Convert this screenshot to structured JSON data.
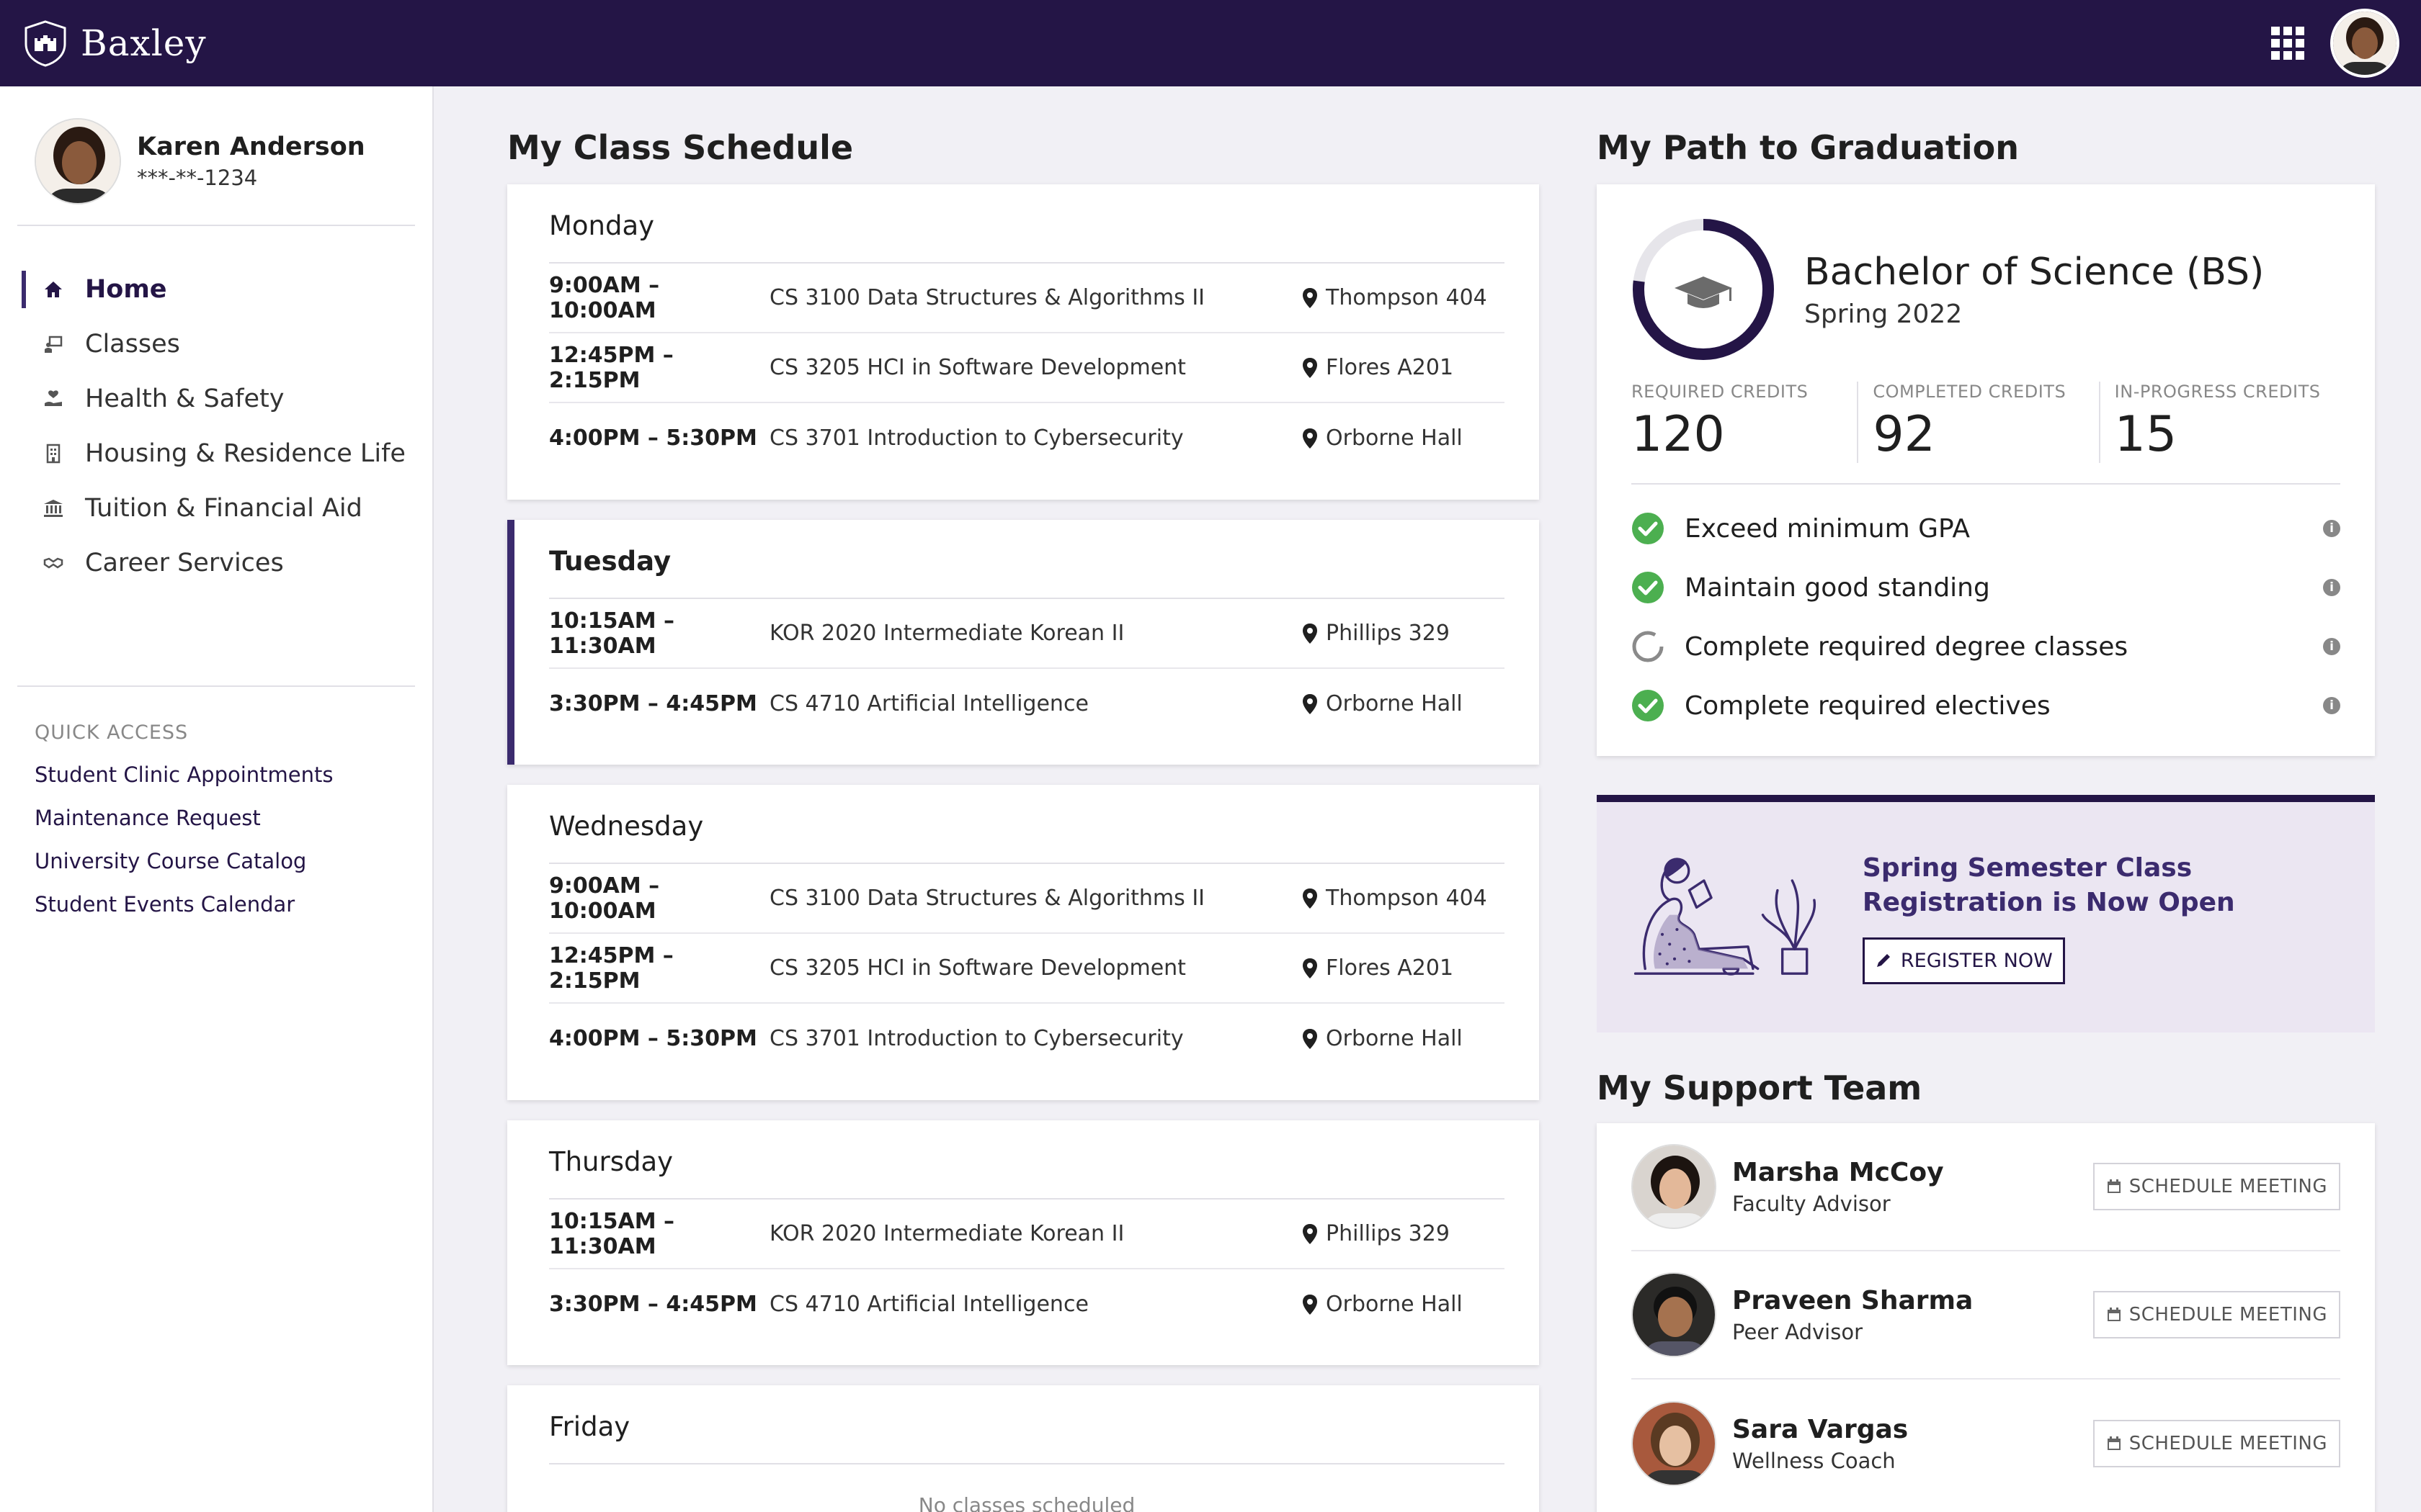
{
  "app": {
    "brand": "Baxley",
    "accent_color": "#241546"
  },
  "user": {
    "name": "Karen Anderson",
    "id_masked": "***-**-1234"
  },
  "nav": {
    "items": [
      {
        "label": "Home",
        "icon": "home-icon",
        "active": true
      },
      {
        "label": "Classes",
        "icon": "classes-icon"
      },
      {
        "label": "Health & Safety",
        "icon": "health-icon"
      },
      {
        "label": "Housing & Residence Life",
        "icon": "building-icon"
      },
      {
        "label": "Tuition & Financial Aid",
        "icon": "bank-icon"
      },
      {
        "label": "Career Services",
        "icon": "handshake-icon"
      }
    ]
  },
  "quick_access": {
    "title": "QUICK ACCESS",
    "links": [
      "Student Clinic Appointments",
      "Maintenance Request",
      "University Course Catalog",
      "Student Events Calendar"
    ]
  },
  "schedule": {
    "title": "My Class Schedule",
    "days": [
      {
        "name": "Monday",
        "classes": [
          {
            "time": "9:00AM – 10:00AM",
            "course": "CS 3100 Data Structures & Algorithms II",
            "location": "Thompson 404"
          },
          {
            "time": "12:45PM – 2:15PM",
            "course": "CS 3205 HCI in Software Development",
            "location": "Flores A201"
          },
          {
            "time": "4:00PM – 5:30PM",
            "course": "CS 3701 Introduction to Cybersecurity",
            "location": "Orborne Hall"
          }
        ]
      },
      {
        "name": "Tuesday",
        "classes": [
          {
            "time": "10:15AM – 11:30AM",
            "course": "KOR 2020 Intermediate Korean II",
            "location": "Phillips 329"
          },
          {
            "time": "3:30PM – 4:45PM",
            "course": "CS 4710 Artificial Intelligence",
            "location": "Orborne Hall"
          }
        ]
      },
      {
        "name": "Wednesday",
        "classes": [
          {
            "time": "9:00AM – 10:00AM",
            "course": "CS 3100 Data Structures & Algorithms II",
            "location": "Thompson 404"
          },
          {
            "time": "12:45PM – 2:15PM",
            "course": "CS 3205 HCI in Software Development",
            "location": "Flores A201"
          },
          {
            "time": "4:00PM – 5:30PM",
            "course": "CS 3701 Introduction to Cybersecurity",
            "location": "Orborne Hall"
          }
        ]
      },
      {
        "name": "Thursday",
        "classes": [
          {
            "time": "10:15AM – 11:30AM",
            "course": "KOR 2020 Intermediate Korean II",
            "location": "Phillips 329"
          },
          {
            "time": "3:30PM – 4:45PM",
            "course": "CS 4710 Artificial Intelligence",
            "location": "Orborne Hall"
          }
        ]
      },
      {
        "name": "Friday",
        "empty_text": "No classes scheduled"
      }
    ]
  },
  "graduation": {
    "title": "My Path to Graduation",
    "degree": "Bachelor of Science (BS)",
    "term": "Spring 2022",
    "progress": 0.77,
    "credits": {
      "required_label": "REQUIRED CREDITS",
      "required": "120",
      "completed_label": "COMPLETED CREDITS",
      "completed": "92",
      "in_progress_label": "IN-PROGRESS CREDITS",
      "in_progress": "15"
    },
    "requirements": [
      {
        "label": "Exceed minimum GPA",
        "status": "complete"
      },
      {
        "label": "Maintain good standing",
        "status": "complete"
      },
      {
        "label": "Complete required degree classes",
        "status": "in-progress"
      },
      {
        "label": "Complete required electives",
        "status": "complete"
      }
    ]
  },
  "promo": {
    "title": "Spring Semester Class Registration is Now Open",
    "button": "REGISTER NOW"
  },
  "support": {
    "title": "My Support Team",
    "button_label": "SCHEDULE MEETING",
    "members": [
      {
        "name": "Marsha McCoy",
        "role": "Faculty Advisor"
      },
      {
        "name": "Praveen Sharma",
        "role": "Peer Advisor"
      },
      {
        "name": "Sara Vargas",
        "role": "Wellness Coach"
      }
    ]
  }
}
